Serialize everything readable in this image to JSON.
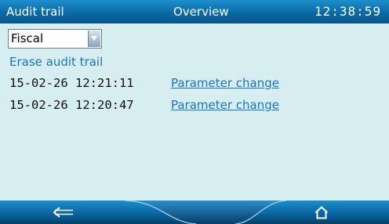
{
  "titlebar": {
    "left_title": "Audit trail",
    "center_title": "Overview",
    "clock": "12:38:59"
  },
  "filter": {
    "selected": "Fiscal",
    "icon": "chevron-down-icon"
  },
  "actions": {
    "erase_label": "Erase audit trail"
  },
  "entries": [
    {
      "timestamp": "15-02-26 12:21:11",
      "event": "Parameter change"
    },
    {
      "timestamp": "15-02-26 12:20:47",
      "event": "Parameter change"
    }
  ],
  "navbar": {
    "back_icon": "back-arrow-icon",
    "home_icon": "home-icon"
  },
  "colors": {
    "titlebar": "#0a6aa6",
    "content_bg": "#d6eef0",
    "link": "#1c74c4"
  }
}
